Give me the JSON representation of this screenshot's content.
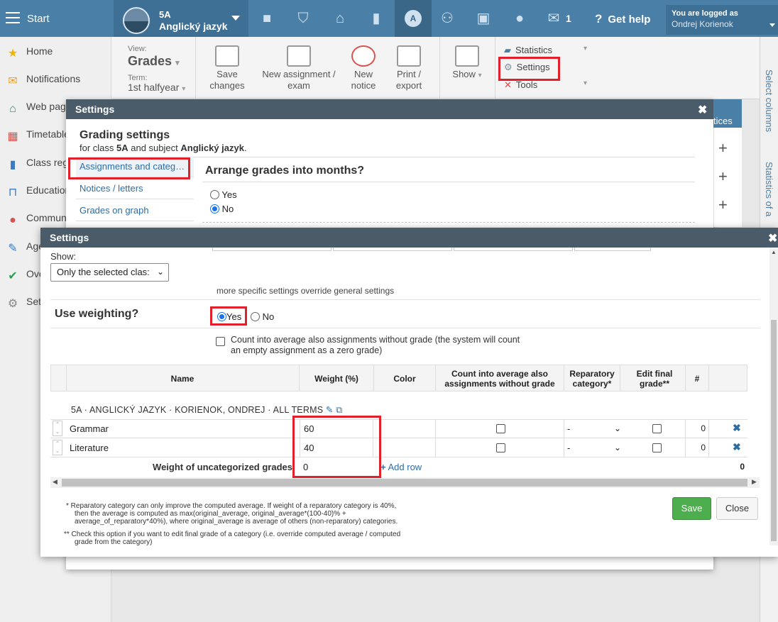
{
  "topbar": {
    "start_label": "Start",
    "class_name": "5A",
    "subject_name": "Anglický jazyk",
    "messages_count": "1",
    "get_help_label": "Get help",
    "logged_in_label": "You are logged as",
    "user_name": "Ondrej Korienok"
  },
  "sidebar": {
    "items": [
      {
        "label": "Home",
        "icon": "star-icon",
        "color": "#f0b400"
      },
      {
        "label": "Notifications",
        "icon": "envelope-icon",
        "color": "#f0a020"
      },
      {
        "label": "Web page",
        "icon": "house-icon",
        "color": "#2e8b57"
      },
      {
        "label": "Timetable",
        "icon": "calendar-icon",
        "color": "#d9534f"
      },
      {
        "label": "Class reg",
        "icon": "book-icon",
        "color": "#3a7bc8"
      },
      {
        "label": "Education",
        "icon": "open-book-icon",
        "color": "#3a7bc8"
      },
      {
        "label": "Commun",
        "icon": "chat-icon",
        "color": "#d9534f"
      },
      {
        "label": "Age",
        "icon": "pen-icon",
        "color": "#3a7bc8"
      },
      {
        "label": "Ove",
        "icon": "check-circle-icon",
        "color": "#2e9e4f"
      },
      {
        "label": "Set",
        "icon": "gear-icon",
        "color": "#888888"
      }
    ]
  },
  "toolbar": {
    "view_label": "View:",
    "view_value": "Grades",
    "term_label": "Term:",
    "term_value": "1st halfyear",
    "save_label": "Save changes",
    "new_assignment_label": "New assignment / exam",
    "new_notice_label": "New notice",
    "print_label": "Print / export",
    "show_label": "Show",
    "statistics_label": "Statistics",
    "settings_label": "Settings",
    "tools_label": "Tools"
  },
  "right_panel": {
    "select_columns": "Select columns",
    "statistics": "Statistics of a"
  },
  "background": {
    "tices_label": "tices"
  },
  "dialog1": {
    "title": "Settings",
    "heading": "Grading settings",
    "sub_prefix": "for class ",
    "sub_class": "5A",
    "sub_mid": " and subject ",
    "sub_subject": "Anglický jazyk",
    "sub_suffix": ".",
    "nav": [
      "Assignments and categ…",
      "Notices / letters",
      "Grades on graph"
    ],
    "arrange_title": "Arrange grades into months?",
    "yes_label": "Yes",
    "no_label": "No"
  },
  "dialog2": {
    "title": "Settings",
    "show_label": "Show:",
    "show_value": "Only the selected clas:",
    "override_note": "more specific settings override general settings",
    "use_weighting_label": "Use weighting?",
    "yes_label": "Yes",
    "no_label": "No",
    "count_note_1": "Count into average also assignments without grade (the system will count",
    "count_note_2": "an empty assignment as a zero grade)",
    "table": {
      "headers": [
        "Name",
        "Weight (%)",
        "Color",
        "Count into average also assignments without grade",
        "Reparatory category*",
        "Edit final grade**",
        "#"
      ],
      "group_title": "5A · ANGLICKÝ JAZYK · KORIENOK, ONDREJ · ALL TERMS",
      "rows": [
        {
          "name": "Grammar",
          "weight": "60",
          "reparatory": "-",
          "count": "0"
        },
        {
          "name": "Literature",
          "weight": "40",
          "reparatory": "-",
          "count": "0"
        }
      ],
      "uncategorized_label": "Weight of uncategorized grades",
      "uncategorized_value": "0",
      "add_row_label": "Add row",
      "total": "0"
    },
    "footnote_1a": "* Reparatory category can only improve the computed average. If weight of a reparatory category is 40%,",
    "footnote_1b": "then the average is computed as max(original_average, original_average*(100-40)% +",
    "footnote_1c": "average_of_reparatory*40%), where original_average is average of others (non-reparatory) categories.",
    "footnote_2a": "** Check this option if you want to edit final grade of a category (i.e. override computed average / computed",
    "footnote_2b": "grade from the category)",
    "save_label": "Save",
    "close_label": "Close"
  },
  "colors": {
    "topbar": "#4a7fa7",
    "dialog_header": "#4a5c69",
    "highlight": "#e0202a",
    "save_button": "#4cae4c",
    "link": "#2e6da4"
  }
}
